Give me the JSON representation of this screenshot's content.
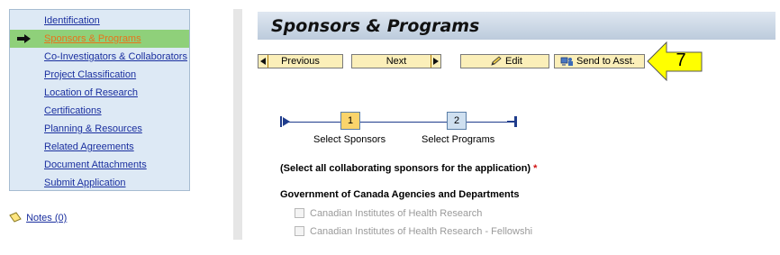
{
  "nav": {
    "items": [
      {
        "label": "Identification",
        "active": false
      },
      {
        "label": "Sponsors & Programs",
        "active": true
      },
      {
        "label": "Co-Investigators & Collaborators",
        "active": false
      },
      {
        "label": "Project Classification",
        "active": false
      },
      {
        "label": "Location of Research",
        "active": false
      },
      {
        "label": "Certifications",
        "active": false
      },
      {
        "label": "Planning & Resources",
        "active": false
      },
      {
        "label": "Related Agreements",
        "active": false
      },
      {
        "label": "Document Attachments",
        "active": false
      },
      {
        "label": "Submit Application",
        "active": false
      }
    ],
    "notes_label": "Notes (0)"
  },
  "page": {
    "title": "Sponsors & Programs"
  },
  "toolbar": {
    "previous_label": "Previous",
    "next_label": "Next",
    "edit_label": "Edit",
    "send_label": "Send to Asst."
  },
  "callout": {
    "number": "7",
    "color": "#ffff00"
  },
  "wizard": {
    "steps": [
      {
        "number": "1",
        "label": "Select Sponsors",
        "current": true
      },
      {
        "number": "2",
        "label": "Select Programs",
        "current": false
      }
    ]
  },
  "form": {
    "instruction": "(Select all collaborating sponsors for the application)",
    "required_mark": "*",
    "group_heading": "Government of Canada Agencies and Departments",
    "options": [
      {
        "label": "Canadian Institutes of Health Research",
        "checked": false,
        "disabled": true
      },
      {
        "label": "Canadian Institutes of Health Research - Fellowshi",
        "checked": false,
        "disabled": true
      }
    ]
  },
  "colors": {
    "nav_bg": "#dde9f5",
    "nav_active_bg": "#8fd07a",
    "link": "#1a2f9f",
    "link_active": "#e8731c",
    "button_bg": "#fbefb9",
    "step_current": "#fad46b",
    "step_other": "#cfe0f0"
  }
}
